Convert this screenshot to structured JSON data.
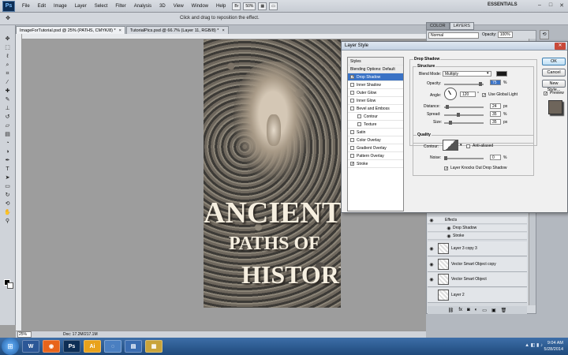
{
  "app": {
    "logo": "Ps",
    "menu": [
      "File",
      "Edit",
      "Image",
      "Layer",
      "Select",
      "Filter",
      "Analysis",
      "3D",
      "View",
      "Window",
      "Help"
    ],
    "zoom_menu": "50%",
    "workspace": "ESSENTIALS",
    "window_buttons": [
      "–",
      "□",
      "✕"
    ]
  },
  "options_bar": {
    "hint": "Click and drag to reposition the effect."
  },
  "doc_tabs": [
    {
      "label": "ImageForTutorial.psd @ 25% (PATHS, CMYK/8) *",
      "close": "×"
    },
    {
      "label": "TutorialPics.psd @ 66.7% (Layer 11, RGB/8) *",
      "close": "×"
    }
  ],
  "poster": {
    "line1": "ANCIENT",
    "line2": "PATHS OF",
    "line3": "HISTORY"
  },
  "status": {
    "zoom": "25%",
    "doc": "Doc: 17.2M/217.1M"
  },
  "panels": {
    "tabs": [
      "COLOR",
      "LAYERS"
    ],
    "blend_mode": "Normal",
    "opacity_label": "Opacity:",
    "opacity_value": "100%",
    "effects_label": "Effects",
    "effects": [
      "Drop Shadow",
      "Stroke"
    ],
    "layers": [
      "Layer 3 copy 3",
      "Vector Smart Object copy",
      "Vector Smart Object",
      "Layer 2"
    ],
    "footer_icons": [
      "⛓",
      "fx",
      "◙",
      "◐",
      "▭",
      "▣",
      "🗑"
    ]
  },
  "dialog": {
    "title": "Layer Style",
    "close": "✕",
    "styles": [
      {
        "label": "Styles",
        "type": "header"
      },
      {
        "label": "Blending Options: Default",
        "type": "header"
      },
      {
        "label": "Drop Shadow",
        "checked": true,
        "selected": true
      },
      {
        "label": "Inner Shadow",
        "checked": false
      },
      {
        "label": "Outer Glow",
        "checked": false
      },
      {
        "label": "Inner Glow",
        "checked": false
      },
      {
        "label": "Bevel and Emboss",
        "checked": false
      },
      {
        "label": "Contour",
        "checked": false,
        "indent": true
      },
      {
        "label": "Texture",
        "checked": false,
        "indent": true
      },
      {
        "label": "Satin",
        "checked": false
      },
      {
        "label": "Color Overlay",
        "checked": false
      },
      {
        "label": "Gradient Overlay",
        "checked": false
      },
      {
        "label": "Pattern Overlay",
        "checked": false
      },
      {
        "label": "Stroke",
        "checked": true
      }
    ],
    "drop_shadow_title": "Drop Shadow",
    "structure_title": "Structure",
    "blend_mode_label": "Blend Mode:",
    "blend_mode": "Multiply",
    "opacity_label": "Opacity:",
    "opacity_value": "75",
    "angle_label": "Angle:",
    "angle_value": "120",
    "global_light_label": "Use Global Light",
    "distance_label": "Distance:",
    "distance_value": "24",
    "spread_label": "Spread:",
    "spread_value": "35",
    "size_label": "Size:",
    "size_value": "35",
    "unit_percent": "%",
    "unit_px": "px",
    "unit_deg": "°",
    "quality_title": "Quality",
    "contour_label": "Contour:",
    "anti_aliased_label": "Anti-aliased",
    "noise_label": "Noise:",
    "noise_value": "0",
    "knockout_label": "Layer Knocks Out Drop Shadow",
    "buttons": {
      "ok": "OK",
      "cancel": "Cancel",
      "new_style": "New Style...",
      "preview": "Preview"
    },
    "shadow_color": "#1a1a1a"
  },
  "taskbar": {
    "apps": [
      {
        "label": "W",
        "color": "#2b5797"
      },
      {
        "label": "◉",
        "color": "#e8641b"
      },
      {
        "label": "Ps",
        "color": "#0d2e55"
      },
      {
        "label": "Ai",
        "color": "#e8a21b"
      },
      {
        "label": "◌",
        "color": "#4a7fc1"
      },
      {
        "label": "▤",
        "color": "#3a6cb0"
      },
      {
        "label": "▦",
        "color": "#c9a43a"
      }
    ],
    "tray_icons": "▲ ◧ ▮ ♪",
    "time": "9:04 AM",
    "date": "5/28/2014"
  }
}
